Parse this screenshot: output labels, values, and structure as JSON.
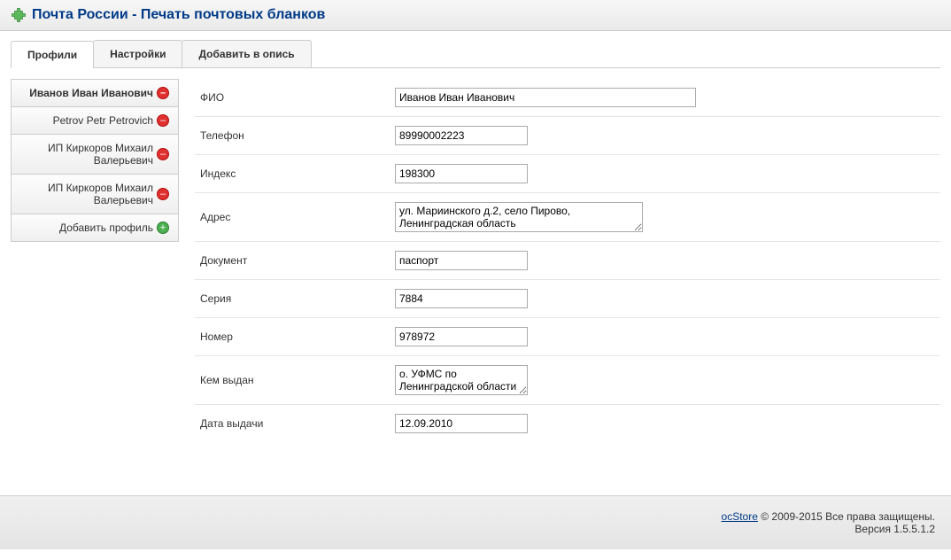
{
  "header": {
    "title": "Почта России - Печать почтовых бланков"
  },
  "tabs": [
    {
      "label": "Профили",
      "active": true
    },
    {
      "label": "Настройки",
      "active": false
    },
    {
      "label": "Добавить в опись",
      "active": false
    }
  ],
  "sidebar": {
    "items": [
      {
        "label": "Иванов Иван Иванович",
        "active": true
      },
      {
        "label": "Petrov Petr Petrovich",
        "active": false
      },
      {
        "label": "ИП Киркоров Михаил Валерьевич",
        "active": false
      },
      {
        "label": "ИП Киркоров Михаил Валерьевич",
        "active": false
      }
    ],
    "add_label": "Добавить профиль"
  },
  "form": {
    "fio": {
      "label": "ФИО",
      "value": "Иванов Иван Иванович"
    },
    "phone": {
      "label": "Телефон",
      "value": "89990002223"
    },
    "index": {
      "label": "Индекс",
      "value": "198300"
    },
    "address": {
      "label": "Адрес",
      "value": "ул. Мариинского д.2, село Пирово, Ленинградская область"
    },
    "document": {
      "label": "Документ",
      "value": "паспорт"
    },
    "series": {
      "label": "Серия",
      "value": "7884"
    },
    "number": {
      "label": "Номер",
      "value": "978972"
    },
    "issued_by": {
      "label": "Кем выдан",
      "value": "о. УФМС по Ленинградской области"
    },
    "issue_date": {
      "label": "Дата выдачи",
      "value": "12.09.2010"
    }
  },
  "footer": {
    "link": "ocStore",
    "copyright": " © 2009-2015 Все права защищены.",
    "version": "Версия 1.5.5.1.2"
  }
}
